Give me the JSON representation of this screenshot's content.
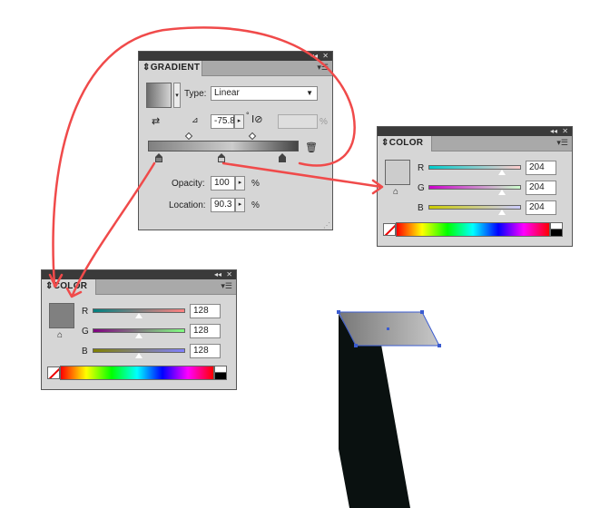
{
  "gradient_panel": {
    "tab": "GRADIENT",
    "type_label": "Type:",
    "type_value": "Linear",
    "angle_value": "-75.8",
    "degree_symbol": "°",
    "aspect_unit": "%",
    "opacity_label": "Opacity:",
    "opacity_value": "100",
    "opacity_unit": "%",
    "location_label": "Location:",
    "location_value": "90.3",
    "location_unit": "%"
  },
  "color_panel_right": {
    "tab": "COLOR",
    "r_label": "R",
    "r_value": "204",
    "g_label": "G",
    "g_value": "204",
    "b_label": "B",
    "b_value": "204",
    "swatch_color": "#cccccc"
  },
  "color_panel_left": {
    "tab": "COLOR",
    "r_label": "R",
    "r_value": "128",
    "g_label": "G",
    "g_value": "128",
    "b_label": "B",
    "b_value": "128",
    "swatch_color": "#808080"
  },
  "colors": {
    "annotation_arrow": "#f04a4a",
    "shape_dark": "#0a1110",
    "selection": "#3a5bd0"
  }
}
